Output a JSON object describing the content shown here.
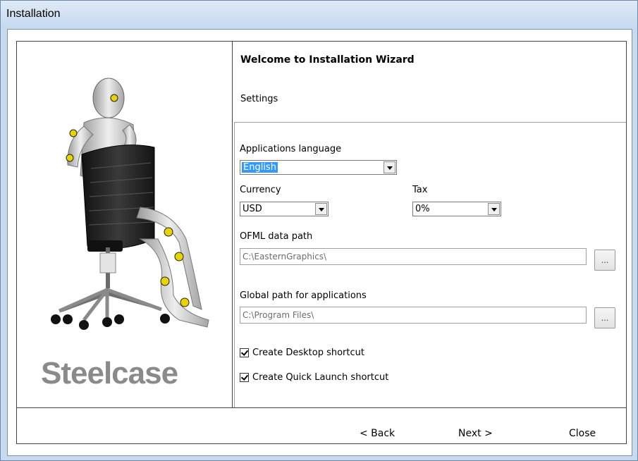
{
  "window": {
    "title": "Installation"
  },
  "wizard": {
    "heading": "Welcome to Installation Wizard",
    "subheading": "Settings"
  },
  "brand": {
    "logo_text": "Steelcase"
  },
  "settings": {
    "language_label": "Applications language",
    "language_value": "English",
    "currency_label": "Currency",
    "currency_value": "USD",
    "tax_label": "Tax",
    "tax_value": "0%",
    "ofml_label": "OFML data path",
    "ofml_value": "C:\\EasternGraphics\\",
    "global_label": "Global path for applications",
    "global_value": "C:\\Program Files\\",
    "browse_label": "...",
    "desktop_shortcut_label": "Create Desktop shortcut",
    "desktop_shortcut_checked": true,
    "quicklaunch_shortcut_label": "Create Quick Launch shortcut",
    "quicklaunch_shortcut_checked": true
  },
  "buttons": {
    "back": "< Back",
    "next": "Next >",
    "close": "Close"
  },
  "colors": {
    "selection": "#3399ff",
    "titlebar": "#c6d9ef",
    "logo": "#8a8a8a"
  }
}
